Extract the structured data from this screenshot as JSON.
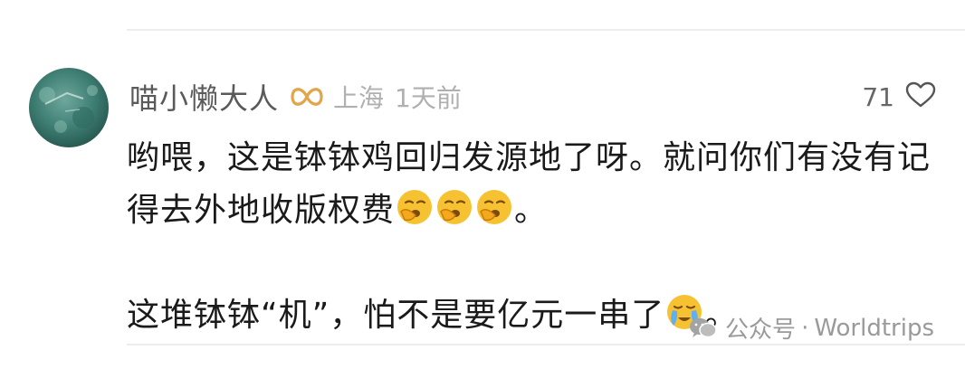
{
  "comment": {
    "username": "喵小懒大人",
    "location": "上海",
    "time": "1天前",
    "like_count": "71",
    "paragraph1_text": "哟喂，这是钵钵鸡回归发源地了呀。就问你们有没有记得去外地收版权费",
    "paragraph1_end": "。",
    "paragraph1_emojis": [
      "yawn-emoji",
      "yawn-emoji",
      "yawn-emoji"
    ],
    "paragraph2_text": "这堆钵钵“机”，怕不是要亿元一串了",
    "paragraph2_end": "。",
    "paragraph2_emojis": [
      "crying-emoji"
    ]
  },
  "badge_icon": "infinity-badge-icon",
  "watermark": {
    "prefix": "公众号",
    "separator": "·",
    "name": "Worldtrips"
  },
  "colors": {
    "username": "#5a5a5a",
    "meta": "#b0b0b0",
    "text": "#1a1a1a",
    "badge": "#e2a64a",
    "emoji": "#f6c232"
  }
}
